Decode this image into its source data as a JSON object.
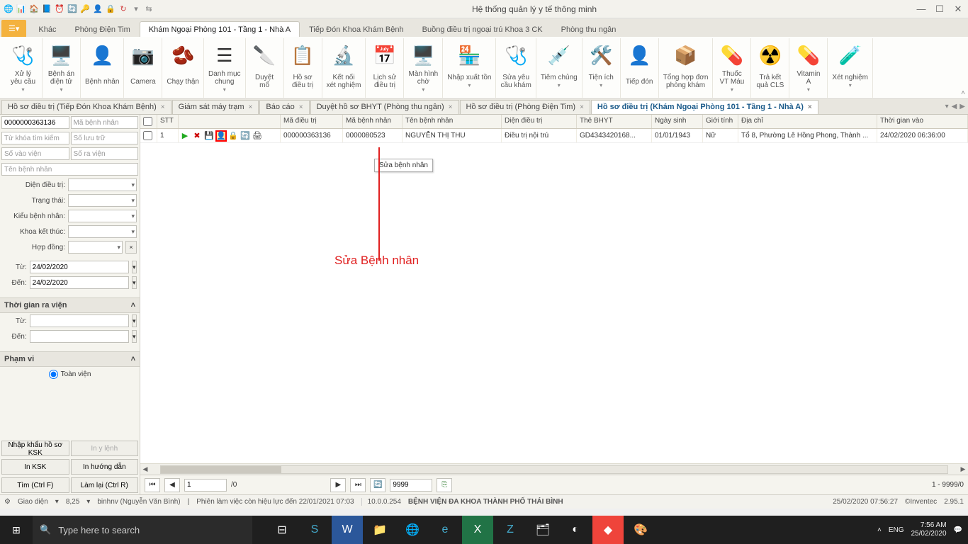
{
  "app": {
    "title": "Hệ thống quản lý y tế thông minh"
  },
  "qat_icons": [
    "🌐",
    "📊",
    "🏠",
    "📘",
    "⏰",
    "🔄",
    "🔑",
    "👤",
    "🔒",
    "↻",
    "⏷",
    "⇆"
  ],
  "main_tabs": [
    {
      "label": "Khác"
    },
    {
      "label": "Phòng Điện Tim"
    },
    {
      "label": "Khám Ngoại Phòng 101 - Tầng 1 - Nhà A",
      "active": true
    },
    {
      "label": "Tiếp Đón Khoa Khám Bệnh"
    },
    {
      "label": "Buồng điều trị ngoại trú Khoa 3 CK"
    },
    {
      "label": "Phòng thu ngân"
    }
  ],
  "ribbon": [
    {
      "label": "Xử lý\nyêu cầu",
      "icon": "🩺",
      "drop": true
    },
    {
      "label": "Bệnh án\nđiện tử",
      "icon": "🖥️",
      "drop": true
    },
    {
      "label": "Bệnh nhân",
      "icon": "👤"
    },
    {
      "label": "Camera",
      "icon": "📷"
    },
    {
      "label": "Chạy thận",
      "icon": "🫘"
    },
    {
      "label": "Danh mục\nchung",
      "icon": "☰",
      "drop": true
    },
    {
      "label": "Duyệt\nmổ",
      "icon": "🔪"
    },
    {
      "label": "Hồ sơ\nđiều trị",
      "icon": "📋"
    },
    {
      "label": "Kết nối\nxét nghiệm",
      "icon": "🔬"
    },
    {
      "label": "Lịch sử\nđiều trị",
      "icon": "📅"
    },
    {
      "label": "Màn hình\nchờ",
      "icon": "🖥️",
      "drop": true
    },
    {
      "label": "Nhập xuất tồn",
      "icon": "🏪",
      "drop": true
    },
    {
      "label": "Sửa yêu\ncầu khám",
      "icon": "🩺"
    },
    {
      "label": "Tiêm chủng",
      "icon": "💉",
      "drop": true
    },
    {
      "label": "Tiện ích",
      "icon": "🛠️",
      "drop": true
    },
    {
      "label": "Tiếp đón",
      "icon": "👤"
    },
    {
      "label": "Tổng hợp đơn\nphòng khám",
      "icon": "📦"
    },
    {
      "label": "Thuốc\nVT Máu",
      "icon": "💊",
      "drop": true
    },
    {
      "label": "Trả kết\nquả CLS",
      "icon": "☢️"
    },
    {
      "label": "Vitamin\nA",
      "icon": "💊",
      "drop": true
    },
    {
      "label": "Xét nghiệm",
      "icon": "🧪",
      "drop": true
    }
  ],
  "doc_tabs": [
    {
      "label": "Hồ sơ điều trị (Tiếp Đón Khoa Khám Bệnh)"
    },
    {
      "label": "Giám sát máy trạm"
    },
    {
      "label": "Báo cáo"
    },
    {
      "label": "Duyệt hồ sơ BHYT (Phòng thu ngân)"
    },
    {
      "label": "Hồ sơ điều trị (Phòng Điện Tim)"
    },
    {
      "label": "Hồ sơ điều trị (Khám Ngoại Phòng 101 - Tầng 1 - Nhà A)",
      "active": true
    }
  ],
  "sidebar": {
    "code_value": "0000000363136",
    "code_placeholder": "Mã bệnh nhân",
    "keyword_placeholder": "Từ khóa tìm kiếm",
    "storage_placeholder": "Số lưu trữ",
    "in_placeholder": "Số vào viện",
    "out_placeholder": "Số ra viện",
    "name_placeholder": "Tên bệnh nhân",
    "labels": {
      "dien": "Diện điều trị:",
      "trangthai": "Trạng thái:",
      "kieu": "Kiểu bệnh nhân:",
      "khoa": "Khoa kết thúc:",
      "hopdong": "Hợp đồng:",
      "tu": "Từ:",
      "den": "Đến:"
    },
    "date_from": "24/02/2020",
    "date_to": "24/02/2020",
    "section_time": "Thời gian ra viện",
    "section_scope": "Phạm vi",
    "scope_radio": "Toàn viện",
    "btn_import": "Nhập khẩu hồ sơ KSK",
    "btn_print_cmd": "In y lệnh",
    "btn_print_ksk": "In KSK",
    "btn_print_guide": "In hướng dẫn",
    "btn_search": "Tìm (Ctrl F)",
    "btn_reset": "Làm lại (Ctrl R)"
  },
  "grid": {
    "headers": [
      "",
      "STT",
      "",
      "Mã điều trị",
      "Mã bệnh nhân",
      "Tên bệnh nhân",
      "Diện điều trị",
      "Thẻ BHYT",
      "Ngày sinh",
      "Giới tính",
      "Địa chỉ",
      "Thời gian vào"
    ],
    "row": {
      "stt": "1",
      "ma_dt": "000000363136",
      "ma_bn": "0000080523",
      "ten": "NGUYỄN THỊ THU",
      "dien": "Điều trị nội trú",
      "bhyt": "GD4343420168...",
      "ns": "01/01/1943",
      "gt": "Nữ",
      "dc": "Tổ 8, Phường Lê Hồng Phong, Thành ...",
      "tg": "24/02/2020 06:36:00"
    },
    "tooltip": "Sửa bệnh nhân"
  },
  "annotation": {
    "text": "Sửa Bệnh nhân"
  },
  "pager": {
    "page": "1",
    "of": "/0",
    "pagesize": "9999",
    "summary": "1 - 9999/0"
  },
  "status": {
    "ui": "Giao diện",
    "zoom": "8,25",
    "user": "binhnv (Nguyễn Văn Bình)",
    "session": "Phiên làm việc còn hiệu lực đến 22/01/2021 07:03",
    "ver": "10.0.0.254",
    "hospital": "BỆNH VIỆN ĐA KHOA THÀNH PHỐ THÁI BÌNH",
    "dt": "25/02/2020 07:56:27",
    "vendor": "©Inventec",
    "build": "2.95.1"
  },
  "taskbar": {
    "search_placeholder": "Type here to search",
    "clock_time": "7:56 AM",
    "clock_date": "25/02/2020",
    "lang": "ENG"
  }
}
